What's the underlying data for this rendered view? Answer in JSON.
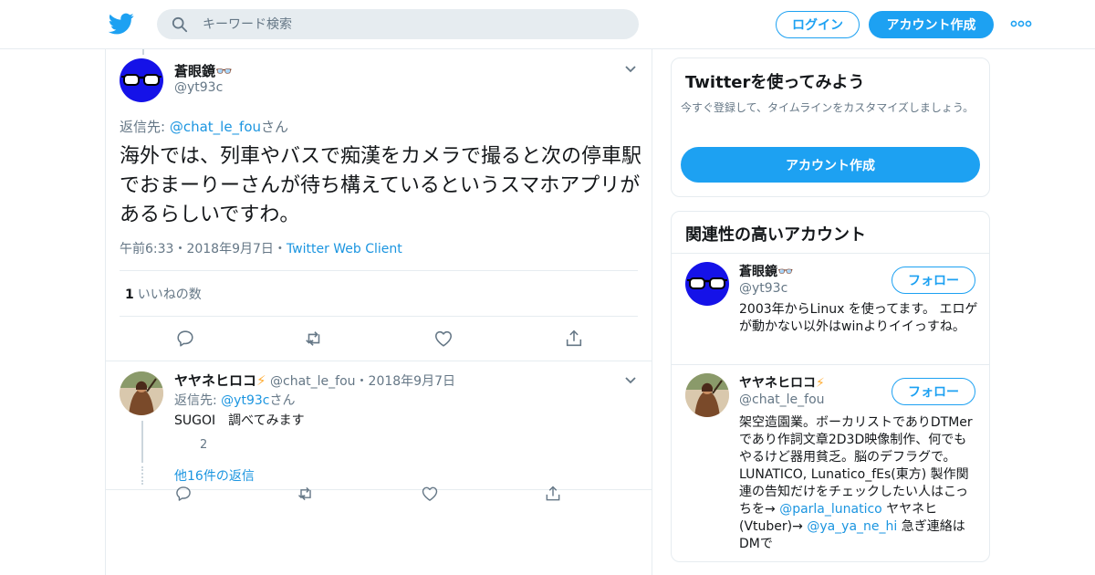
{
  "header": {
    "search_placeholder": "キーワード検索",
    "login_label": "ログイン",
    "signup_label": "アカウント作成",
    "brand_color": "#1da1f2"
  },
  "main_tweet": {
    "display_name": "蒼眼鏡👓",
    "handle": "@yt93c",
    "reply_prefix": "返信先: ",
    "reply_to": "@chat_le_fou",
    "reply_suffix": "さん",
    "text": "海外では、列車やバスで痴漢をカメラで撮ると次の停車駅でおまーりーさんが待ち構えているというスマホアプリがあるらしいですわ。",
    "time": "午前6:33",
    "date": "2018年9月7日",
    "client": "Twitter Web Client",
    "sep": "・",
    "likes_count": "1",
    "likes_label": "いいねの数"
  },
  "reply_tweet": {
    "display_name": "ヤヤネヒロコ",
    "bolt": "⚡",
    "handle": "@chat_le_fou",
    "sep": "・",
    "date": "2018年9月7日",
    "reply_prefix": "返信先: ",
    "reply_to": "@yt93c",
    "reply_suffix": "さん",
    "text": "SUGOI　調べてみます",
    "reply_count": "2",
    "more_replies": "他16件の返信"
  },
  "signup_card": {
    "title": "Twitterを使ってみよう",
    "description": "今すぐ登録して、タイムラインをカスタマイズしましょう。",
    "button_label": "アカウント作成"
  },
  "related_accounts": {
    "title": "関連性の高いアカウント",
    "users": [
      {
        "display_name": "蒼眼鏡👓",
        "handle": "@yt93c",
        "follow_label": "フォロー",
        "bio": "2003年からLinux を使ってます。 エロゲが動かない以外はwinよりイイっすね。"
      },
      {
        "display_name": "ヤヤネヒロコ",
        "bolt": "⚡",
        "handle": "@chat_le_fou",
        "follow_label": "フォロー",
        "bio_1": "架空造園業。ボーカリストでありDTMerであり作詞文章2D3D映像制作、何でもやるけど器用貧乏。脳のデフラグで。LUNATICO, Lunatico_fEs(東方) 製作関連の告知だけをチェックしたい人はこっちを→ ",
        "bio_link_1": "@parla_lunatico",
        "bio_2": " ヤヤネヒ(Vtuber)→ ",
        "bio_link_2": "@ya_ya_ne_hi",
        "bio_3": " 急ぎ連絡はDMで"
      }
    ]
  }
}
